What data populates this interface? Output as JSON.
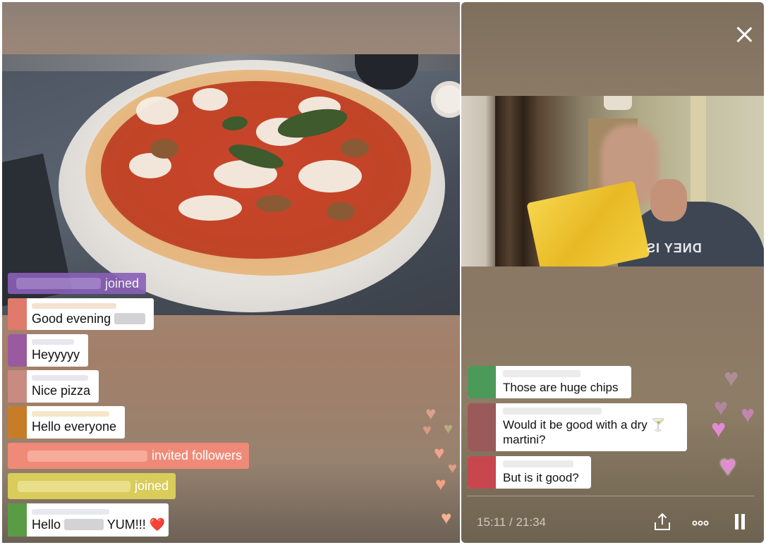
{
  "left_chat": {
    "joined_label": "joined",
    "messages": [
      {
        "text": "Good evening",
        "avatar_color": "#e07a6b"
      },
      {
        "text": "Heyyyyy",
        "avatar_color": "#9a5aa0"
      },
      {
        "text": "Nice pizza",
        "avatar_color": "#c98a80"
      },
      {
        "text": "Hello everyone",
        "avatar_color": "#c77c28"
      },
      {
        "text_a": "Hello",
        "text_b": "YUM!!! ❤️",
        "avatar_color": "#5a9b45"
      }
    ],
    "invited_label": "invited followers",
    "joined_label_2": "joined",
    "colors": {
      "purple": "#8a5fb8",
      "salmon": "#f08a78",
      "yellow": "#d9cc5a"
    }
  },
  "right_chat": {
    "messages": [
      {
        "text": "Those are huge chips",
        "avatar_color": "#4c9a5a"
      },
      {
        "text": "Would it be good with a dry 🍸 martini?",
        "avatar_color": "#9b5a5a"
      },
      {
        "text": "But is it good?",
        "avatar_color": "#c8474f"
      }
    ]
  },
  "video": {
    "shirt_text": "DNEY IS"
  },
  "controls": {
    "time": "15:11 / 21:34",
    "icons": [
      "share-icon",
      "more-options-icon",
      "pause-icon"
    ]
  },
  "hearts_color": "#f3a48d",
  "hearts_color_right": "#e38bd2"
}
